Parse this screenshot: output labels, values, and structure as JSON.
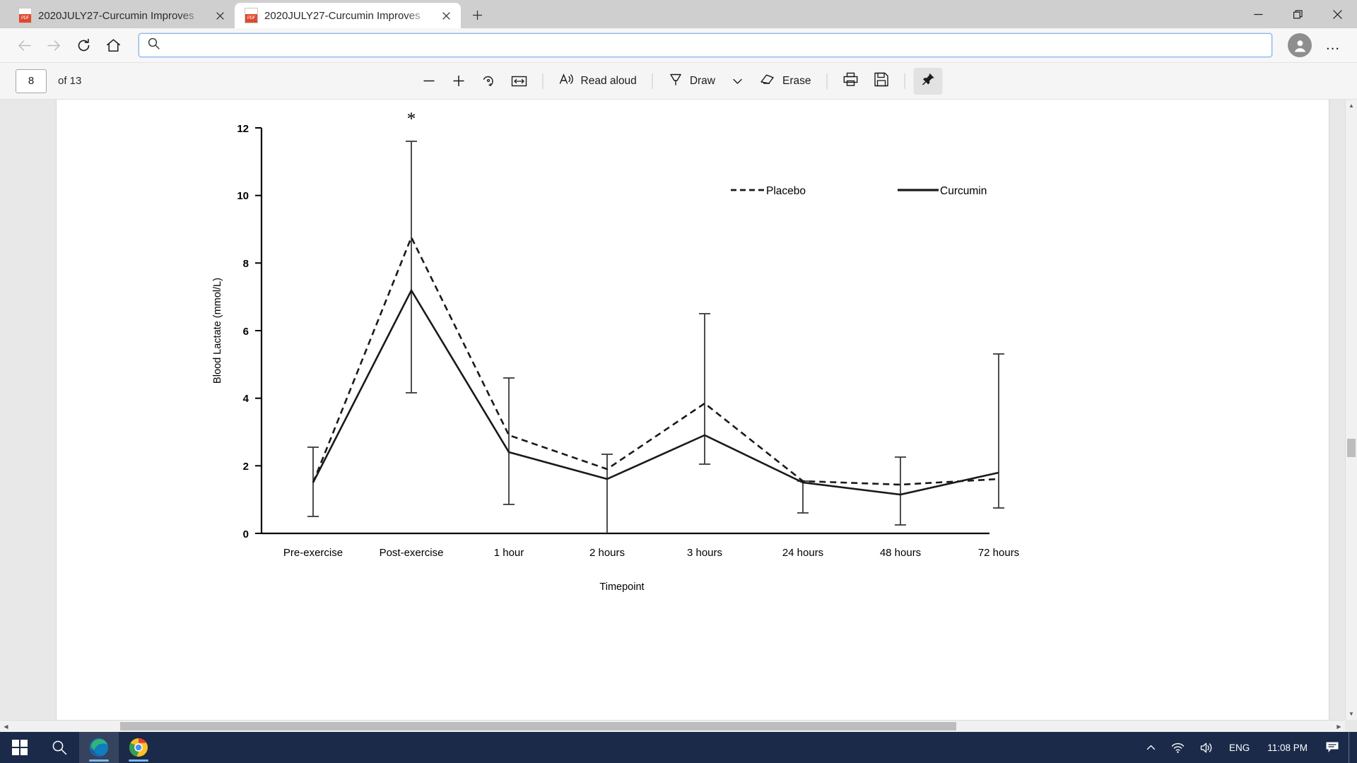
{
  "window": {
    "controls": {
      "minimize": "minimize-button",
      "maximize": "maximize-button",
      "close": "close-button"
    }
  },
  "tabs": [
    {
      "title": "2020JULY27-Curcumin Improves",
      "active": false
    },
    {
      "title": "2020JULY27-Curcumin Improves",
      "active": true
    }
  ],
  "newtab_label": "+",
  "nav": {
    "back": "back-button",
    "forward": "forward-button",
    "reload": "reload-button",
    "home": "home-button",
    "ellipsis": "…"
  },
  "address": {
    "value": "",
    "placeholder": ""
  },
  "pdf_toolbar": {
    "page_number": "8",
    "page_total": "of 13",
    "zoom_out": "−",
    "zoom_in": "+",
    "rotate": "rotate-button",
    "fit_width": "fit-to-width-button",
    "read_aloud": "Read aloud",
    "draw": "Draw",
    "draw_chevron": "⌄",
    "erase": "Erase",
    "print": "print-button",
    "save": "save-button",
    "pin": "pin-button"
  },
  "taskbar": {
    "start": "windows-start-button",
    "search": "taskbar-search-button",
    "edge": "microsoft-edge-button",
    "chrome": "google-chrome-button",
    "show_hidden": "^",
    "network": "network-icon",
    "volume": "volume-icon",
    "language": "ENG",
    "time": "11:08 PM",
    "notifications": "notifications-button"
  },
  "chart_data": {
    "type": "line",
    "title": "",
    "xlabel": "Timepoint",
    "ylabel": "Blood Lactate (mmol/L)",
    "ylim": [
      0,
      12
    ],
    "yticks": [
      0,
      2,
      4,
      6,
      8,
      10,
      12
    ],
    "grid": false,
    "legend_position": "top-center",
    "categories": [
      "Pre-exercise",
      "Post-exercise",
      "1 hour",
      "2 hours",
      "3 hours",
      "24 hours",
      "48 hours",
      "72 hours"
    ],
    "series": [
      {
        "name": "Placebo",
        "style": "dashed",
        "values": [
          1.5,
          8.75,
          2.9,
          1.9,
          3.85,
          1.55,
          1.45,
          1.6
        ],
        "errors_upper": [
          2.55,
          11.6,
          4.6,
          2.35,
          6.5,
          1.55,
          2.25,
          5.3
        ],
        "errors_lower": [
          0.5,
          4.15,
          0.85,
          0.0,
          2.05,
          0.6,
          0.25,
          0.75
        ]
      },
      {
        "name": "Curcumin",
        "style": "solid",
        "values": [
          1.5,
          7.2,
          2.4,
          1.6,
          2.9,
          1.5,
          1.15,
          1.8
        ],
        "errors_upper": [],
        "errors_lower": []
      }
    ],
    "annotations": [
      {
        "text": "*",
        "category": "Post-exercise",
        "value": 11.95
      }
    ]
  }
}
